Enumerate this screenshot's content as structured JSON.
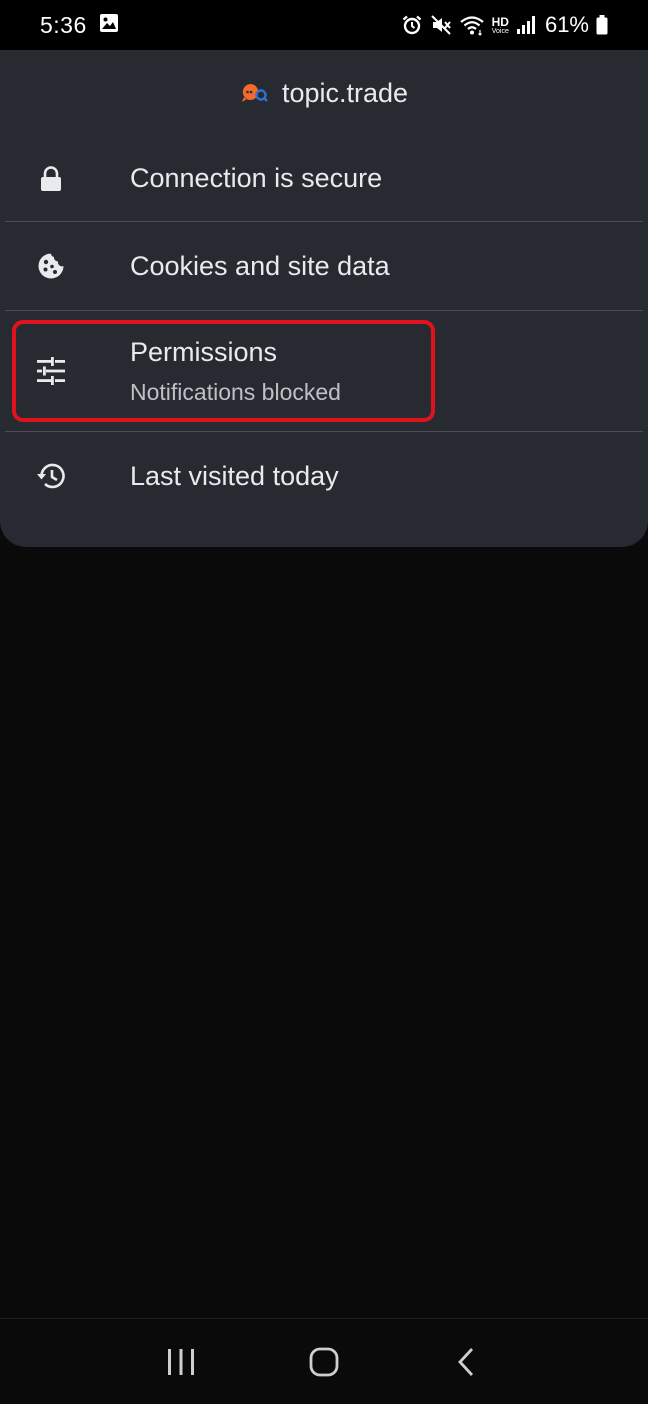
{
  "status_bar": {
    "time": "5:36",
    "battery": "61%",
    "signal_hd_top": "HD",
    "signal_hd_bottom": "Voice",
    "icons": [
      "gallery-icon",
      "alarm-icon",
      "mute-icon",
      "wifi-icon",
      "hd-voice-icon",
      "signal-icon",
      "battery-icon"
    ]
  },
  "sheet": {
    "site_name": "topic.trade",
    "rows": [
      {
        "icon": "lock-icon",
        "title": "Connection is secure"
      },
      {
        "icon": "cookie-icon",
        "title": "Cookies and site data"
      },
      {
        "icon": "tune-icon",
        "title": "Permissions",
        "subtitle": "Notifications blocked"
      },
      {
        "icon": "history-icon",
        "title": "Last visited today"
      }
    ]
  },
  "colors": {
    "sheet_bg": "#282a31",
    "page_bg": "#0a0a0a",
    "highlight": "#e0131c",
    "favicon_orange": "#f26b2b",
    "favicon_blue": "#2f6fd6"
  },
  "nav_bar": {
    "buttons": [
      "recents-button",
      "home-button",
      "back-button"
    ]
  }
}
